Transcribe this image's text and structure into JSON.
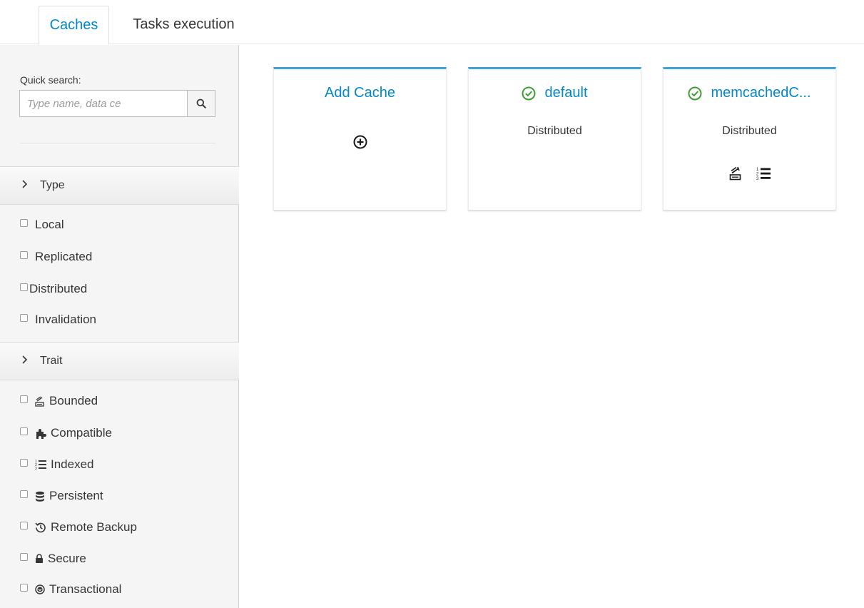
{
  "tabs": [
    {
      "label": "Caches",
      "active": true
    },
    {
      "label": "Tasks execution",
      "active": false
    }
  ],
  "sidebar": {
    "quick_search_label": "Quick search:",
    "search_placeholder": "Type name, data ce",
    "type_section": {
      "title": "Type",
      "options": [
        "Local",
        "Replicated",
        "Distributed",
        "Invalidation"
      ]
    },
    "trait_section": {
      "title": "Trait",
      "options": [
        {
          "label": "Bounded",
          "icon": "bounded-icon"
        },
        {
          "label": "Compatible",
          "icon": "puzzle-icon"
        },
        {
          "label": "Indexed",
          "icon": "ordered-list-icon"
        },
        {
          "label": "Persistent",
          "icon": "database-icon"
        },
        {
          "label": "Remote Backup",
          "icon": "history-icon"
        },
        {
          "label": "Secure",
          "icon": "lock-icon"
        },
        {
          "label": "Transactional",
          "icon": "arrow-circle-down-icon"
        }
      ]
    }
  },
  "cards": [
    {
      "title": "Add Cache",
      "subtitle": "",
      "icon": "plus-circle-icon"
    },
    {
      "title": "default",
      "subtitle": "Distributed",
      "status_icon": "check-circle-icon"
    },
    {
      "title": "memcachedC...",
      "subtitle": "Distributed",
      "status_icon": "check-circle-icon",
      "trait_icons": [
        "bounded-icon",
        "ordered-list-icon"
      ]
    }
  ],
  "colors": {
    "accent": "#0088ce",
    "card_top_border": "#39a5dc",
    "status_ok": "#3f9c35"
  }
}
